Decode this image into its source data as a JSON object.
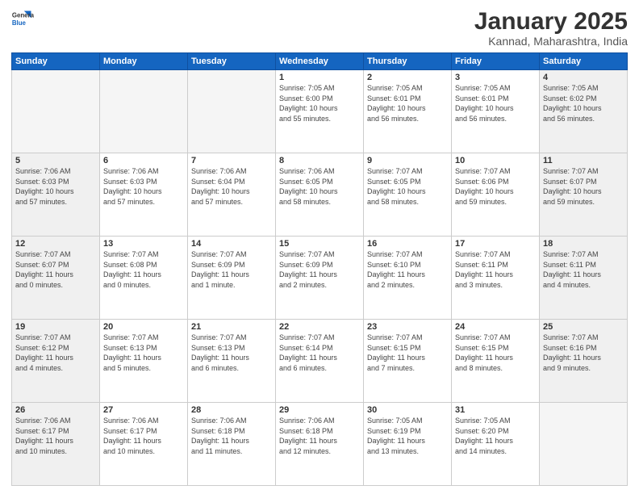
{
  "header": {
    "logo_line1": "General",
    "logo_line2": "Blue",
    "month": "January 2025",
    "location": "Kannad, Maharashtra, India"
  },
  "weekdays": [
    "Sunday",
    "Monday",
    "Tuesday",
    "Wednesday",
    "Thursday",
    "Friday",
    "Saturday"
  ],
  "weeks": [
    [
      {
        "day": "",
        "info": "",
        "empty": true
      },
      {
        "day": "",
        "info": "",
        "empty": true
      },
      {
        "day": "",
        "info": "",
        "empty": true
      },
      {
        "day": "1",
        "info": "Sunrise: 7:05 AM\nSunset: 6:00 PM\nDaylight: 10 hours\nand 55 minutes."
      },
      {
        "day": "2",
        "info": "Sunrise: 7:05 AM\nSunset: 6:01 PM\nDaylight: 10 hours\nand 56 minutes."
      },
      {
        "day": "3",
        "info": "Sunrise: 7:05 AM\nSunset: 6:01 PM\nDaylight: 10 hours\nand 56 minutes."
      },
      {
        "day": "4",
        "info": "Sunrise: 7:05 AM\nSunset: 6:02 PM\nDaylight: 10 hours\nand 56 minutes."
      }
    ],
    [
      {
        "day": "5",
        "info": "Sunrise: 7:06 AM\nSunset: 6:03 PM\nDaylight: 10 hours\nand 57 minutes."
      },
      {
        "day": "6",
        "info": "Sunrise: 7:06 AM\nSunset: 6:03 PM\nDaylight: 10 hours\nand 57 minutes."
      },
      {
        "day": "7",
        "info": "Sunrise: 7:06 AM\nSunset: 6:04 PM\nDaylight: 10 hours\nand 57 minutes."
      },
      {
        "day": "8",
        "info": "Sunrise: 7:06 AM\nSunset: 6:05 PM\nDaylight: 10 hours\nand 58 minutes."
      },
      {
        "day": "9",
        "info": "Sunrise: 7:07 AM\nSunset: 6:05 PM\nDaylight: 10 hours\nand 58 minutes."
      },
      {
        "day": "10",
        "info": "Sunrise: 7:07 AM\nSunset: 6:06 PM\nDaylight: 10 hours\nand 59 minutes."
      },
      {
        "day": "11",
        "info": "Sunrise: 7:07 AM\nSunset: 6:07 PM\nDaylight: 10 hours\nand 59 minutes."
      }
    ],
    [
      {
        "day": "12",
        "info": "Sunrise: 7:07 AM\nSunset: 6:07 PM\nDaylight: 11 hours\nand 0 minutes."
      },
      {
        "day": "13",
        "info": "Sunrise: 7:07 AM\nSunset: 6:08 PM\nDaylight: 11 hours\nand 0 minutes."
      },
      {
        "day": "14",
        "info": "Sunrise: 7:07 AM\nSunset: 6:09 PM\nDaylight: 11 hours\nand 1 minute."
      },
      {
        "day": "15",
        "info": "Sunrise: 7:07 AM\nSunset: 6:09 PM\nDaylight: 11 hours\nand 2 minutes."
      },
      {
        "day": "16",
        "info": "Sunrise: 7:07 AM\nSunset: 6:10 PM\nDaylight: 11 hours\nand 2 minutes."
      },
      {
        "day": "17",
        "info": "Sunrise: 7:07 AM\nSunset: 6:11 PM\nDaylight: 11 hours\nand 3 minutes."
      },
      {
        "day": "18",
        "info": "Sunrise: 7:07 AM\nSunset: 6:11 PM\nDaylight: 11 hours\nand 4 minutes."
      }
    ],
    [
      {
        "day": "19",
        "info": "Sunrise: 7:07 AM\nSunset: 6:12 PM\nDaylight: 11 hours\nand 4 minutes."
      },
      {
        "day": "20",
        "info": "Sunrise: 7:07 AM\nSunset: 6:13 PM\nDaylight: 11 hours\nand 5 minutes."
      },
      {
        "day": "21",
        "info": "Sunrise: 7:07 AM\nSunset: 6:13 PM\nDaylight: 11 hours\nand 6 minutes."
      },
      {
        "day": "22",
        "info": "Sunrise: 7:07 AM\nSunset: 6:14 PM\nDaylight: 11 hours\nand 6 minutes."
      },
      {
        "day": "23",
        "info": "Sunrise: 7:07 AM\nSunset: 6:15 PM\nDaylight: 11 hours\nand 7 minutes."
      },
      {
        "day": "24",
        "info": "Sunrise: 7:07 AM\nSunset: 6:15 PM\nDaylight: 11 hours\nand 8 minutes."
      },
      {
        "day": "25",
        "info": "Sunrise: 7:07 AM\nSunset: 6:16 PM\nDaylight: 11 hours\nand 9 minutes."
      }
    ],
    [
      {
        "day": "26",
        "info": "Sunrise: 7:06 AM\nSunset: 6:17 PM\nDaylight: 11 hours\nand 10 minutes."
      },
      {
        "day": "27",
        "info": "Sunrise: 7:06 AM\nSunset: 6:17 PM\nDaylight: 11 hours\nand 10 minutes."
      },
      {
        "day": "28",
        "info": "Sunrise: 7:06 AM\nSunset: 6:18 PM\nDaylight: 11 hours\nand 11 minutes."
      },
      {
        "day": "29",
        "info": "Sunrise: 7:06 AM\nSunset: 6:18 PM\nDaylight: 11 hours\nand 12 minutes."
      },
      {
        "day": "30",
        "info": "Sunrise: 7:05 AM\nSunset: 6:19 PM\nDaylight: 11 hours\nand 13 minutes."
      },
      {
        "day": "31",
        "info": "Sunrise: 7:05 AM\nSunset: 6:20 PM\nDaylight: 11 hours\nand 14 minutes."
      },
      {
        "day": "",
        "info": "",
        "empty": true
      }
    ]
  ]
}
